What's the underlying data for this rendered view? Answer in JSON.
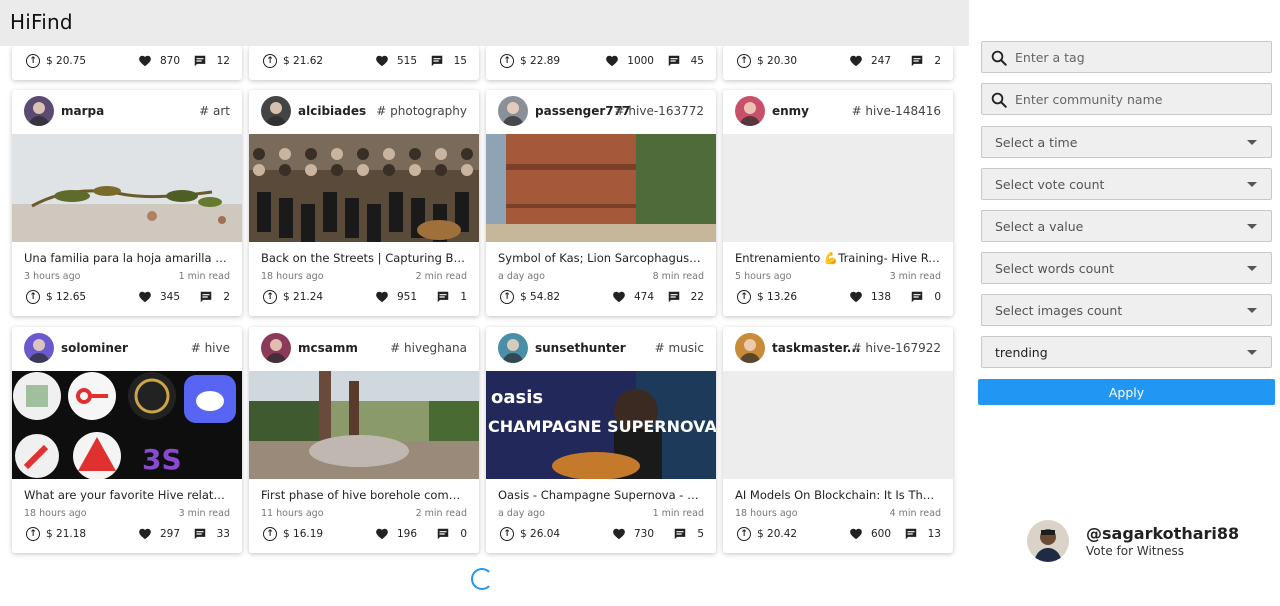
{
  "app": {
    "title": "HiFind"
  },
  "top_row": [
    {
      "payout": "$ 20.75",
      "votes": "870",
      "comments": "12"
    },
    {
      "payout": "$ 21.62",
      "votes": "515",
      "comments": "15"
    },
    {
      "payout": "$ 22.89",
      "votes": "1000",
      "comments": "45"
    },
    {
      "payout": "$ 20.30",
      "votes": "247",
      "comments": "2"
    }
  ],
  "posts": [
    {
      "author": "marpa",
      "tag": "# art",
      "title": "Una familia para la hoja amarilla / A ...",
      "age": "3 hours ago",
      "read": "1 min read",
      "payout": "$ 12.65",
      "votes": "345",
      "comments": "2",
      "avatar_color": "#5b4a72",
      "thumb": "leaves"
    },
    {
      "author": "alcibiades",
      "tag": "# photography",
      "title": "Back on the Streets | Capturing Belg...",
      "age": "18 hours ago",
      "read": "2 min read",
      "payout": "$ 21.24",
      "votes": "951",
      "comments": "1",
      "avatar_color": "#444444",
      "thumb": "orchestra"
    },
    {
      "author": "passenger777",
      "tag": "# hive-163772",
      "title": "Symbol of Kas; Lion Sarcophagus, To...",
      "age": "a day ago",
      "read": "8 min read",
      "payout": "$ 54.82",
      "votes": "474",
      "comments": "22",
      "avatar_color": "#8a8f99",
      "thumb": "sarcophagus"
    },
    {
      "author": "enmy",
      "tag": "# hive-148416",
      "title": "Entrenamiento 💪Training- Hive Run...",
      "age": "5 hours ago",
      "read": "3 min read",
      "payout": "$ 13.26",
      "votes": "138",
      "comments": "0",
      "avatar_color": "#c9506a",
      "thumb": "blank"
    },
    {
      "author": "solominer",
      "tag": "# hive",
      "title": "What are your favorite Hive related ...",
      "age": "18 hours ago",
      "read": "3 min read",
      "payout": "$ 21.18",
      "votes": "297",
      "comments": "33",
      "avatar_color": "#6a5acd",
      "thumb": "icons"
    },
    {
      "author": "mcsamm",
      "tag": "# hiveghana",
      "title": "First phase of hive borehole comme...",
      "age": "11 hours ago",
      "read": "2 min read",
      "payout": "$ 16.19",
      "votes": "196",
      "comments": "0",
      "avatar_color": "#8b3a5a",
      "thumb": "borehole"
    },
    {
      "author": "sunsethunter",
      "tag": "# music",
      "title": "Oasis - Champagne Supernova - Aco...",
      "age": "a day ago",
      "read": "1 min read",
      "payout": "$ 26.04",
      "votes": "730",
      "comments": "5",
      "avatar_color": "#4a8fa8",
      "thumb": "oasis",
      "thumb_text1": "oasis",
      "thumb_text2": "CHAMPAGNE SUPERNOVA"
    },
    {
      "author": "taskmaster...",
      "tag": "# hive-167922",
      "title": "AI Models On Blockchain: It Is The F...",
      "age": "18 hours ago",
      "read": "4 min read",
      "payout": "$ 20.42",
      "votes": "600",
      "comments": "13",
      "avatar_color": "#c98a3a",
      "thumb": "blank"
    }
  ],
  "sidebar": {
    "tag_placeholder": "Enter a tag",
    "community_placeholder": "Enter community name",
    "selects": [
      "Select a time",
      "Select vote count",
      "Select a value",
      "Select words count",
      "Select images count",
      "trending"
    ],
    "apply_label": "Apply"
  },
  "profile": {
    "handle": "@sagarkothari88",
    "subtitle": "Vote for Witness"
  },
  "colors": {
    "accent": "#2196f3",
    "header_bg": "#ebebeb"
  }
}
